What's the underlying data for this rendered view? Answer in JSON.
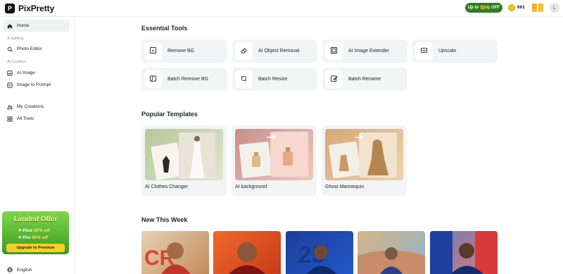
{
  "app": {
    "logo_text": "PixPretty",
    "logo_glyph": "P"
  },
  "header": {
    "promo": {
      "prefix": "Up to",
      "highlight": "50%",
      "suffix": "OFF"
    },
    "credits": "661",
    "avatar_initial": "L"
  },
  "sidebar": {
    "home": "Home",
    "section_editing": "AI Editing",
    "photo_editor": "Photo Editor",
    "section_creation": "AI Creation",
    "ai_image": "AI Image",
    "image_to_prompt": "Image to Prompt",
    "my_creations": "My Creations",
    "all_tools": "All Tools",
    "offer": {
      "title": "Limited Offer",
      "plus_label": "Plus",
      "plus_pct": "50% off",
      "pro_label": "Pro",
      "pro_pct": "40% off",
      "button": "Upgrade to Premium"
    },
    "language": "English"
  },
  "main": {
    "essential_title": "Essential Tools",
    "tools": [
      {
        "label": "Remove BG",
        "icon": "ai-frame-icon"
      },
      {
        "label": "AI Object Removal",
        "icon": "eraser-icon"
      },
      {
        "label": "AI Image Extender",
        "icon": "expand-icon"
      },
      {
        "label": "Upscale",
        "icon": "hd-icon"
      },
      {
        "label": "Batch Remove BG",
        "icon": "batch-frame-icon"
      },
      {
        "label": "Batch Resize",
        "icon": "resize-icon"
      },
      {
        "label": "Batch Rename",
        "icon": "edit-icon"
      }
    ],
    "templates_title": "Popular Templates",
    "templates": [
      {
        "label": "AI Clothes Changer"
      },
      {
        "label": "AI background"
      },
      {
        "label": "Ghost Mannequin"
      }
    ],
    "new_title": "New This Week",
    "new_items_count_visible": 5
  },
  "colors": {
    "accent_green": "#2f7d1f",
    "card_bg": "#f3f4f6",
    "offer_yellow": "#ffcf1f"
  }
}
